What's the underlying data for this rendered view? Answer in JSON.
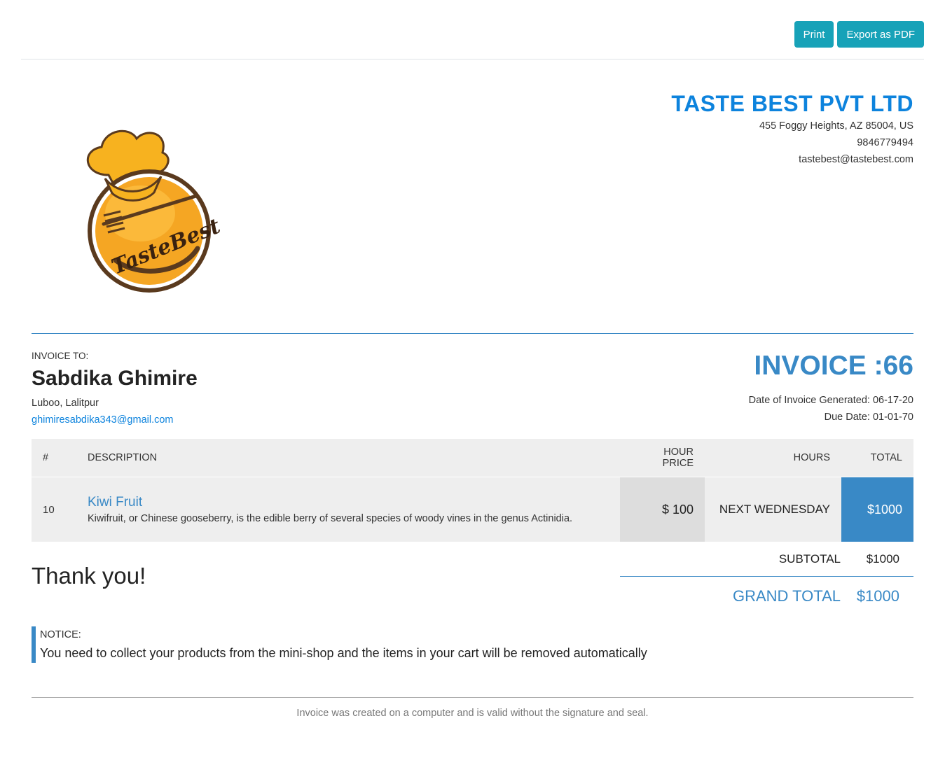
{
  "toolbar": {
    "print_label": "Print",
    "export_label": "Export as PDF"
  },
  "logo": {
    "text": "TasteBest"
  },
  "company": {
    "name": "TASTE BEST PVT LTD",
    "address": "455 Foggy Heights, AZ 85004, US",
    "phone": "9846779494",
    "email": "tastebest@tastebest.com"
  },
  "invoice_to": {
    "label": "INVOICE TO:",
    "name": "Sabdika Ghimire",
    "address": "Luboo, Lalitpur",
    "email": "ghimiresabdika343@gmail.com"
  },
  "invoice": {
    "title": "INVOICE :66",
    "date_generated": "Date of Invoice Generated: 06-17-20",
    "due_date": "Due Date: 01-01-70"
  },
  "table": {
    "headers": {
      "no": "#",
      "description": "DESCRIPTION",
      "price": "HOUR PRICE",
      "hours": "HOURS",
      "total": "TOTAL"
    },
    "rows": [
      {
        "no": "10",
        "title": "Kiwi Fruit",
        "description": "Kiwifruit, or Chinese gooseberry, is the edible berry of several species of woody vines in the genus Actinidia.",
        "price": "$ 100",
        "hours": "NEXT WEDNESDAY",
        "total": "$1000"
      }
    ]
  },
  "totals": {
    "subtotal_label": "SUBTOTAL",
    "subtotal_value": "$1000",
    "grand_label": "GRAND TOTAL",
    "grand_value": "$1000"
  },
  "thanks": "Thank you!",
  "notice": {
    "label": "NOTICE:",
    "text": "You need to collect your products from the mini-shop and the items in your cart will be removed automatically"
  },
  "footer": "Invoice was created on a computer and is valid without the signature and seal.",
  "colors": {
    "accent": "#3989c6",
    "brand": "#0d83dd",
    "button": "#17a2b8",
    "logo_orange": "#f5a623",
    "logo_brown": "#5a3a1e"
  }
}
